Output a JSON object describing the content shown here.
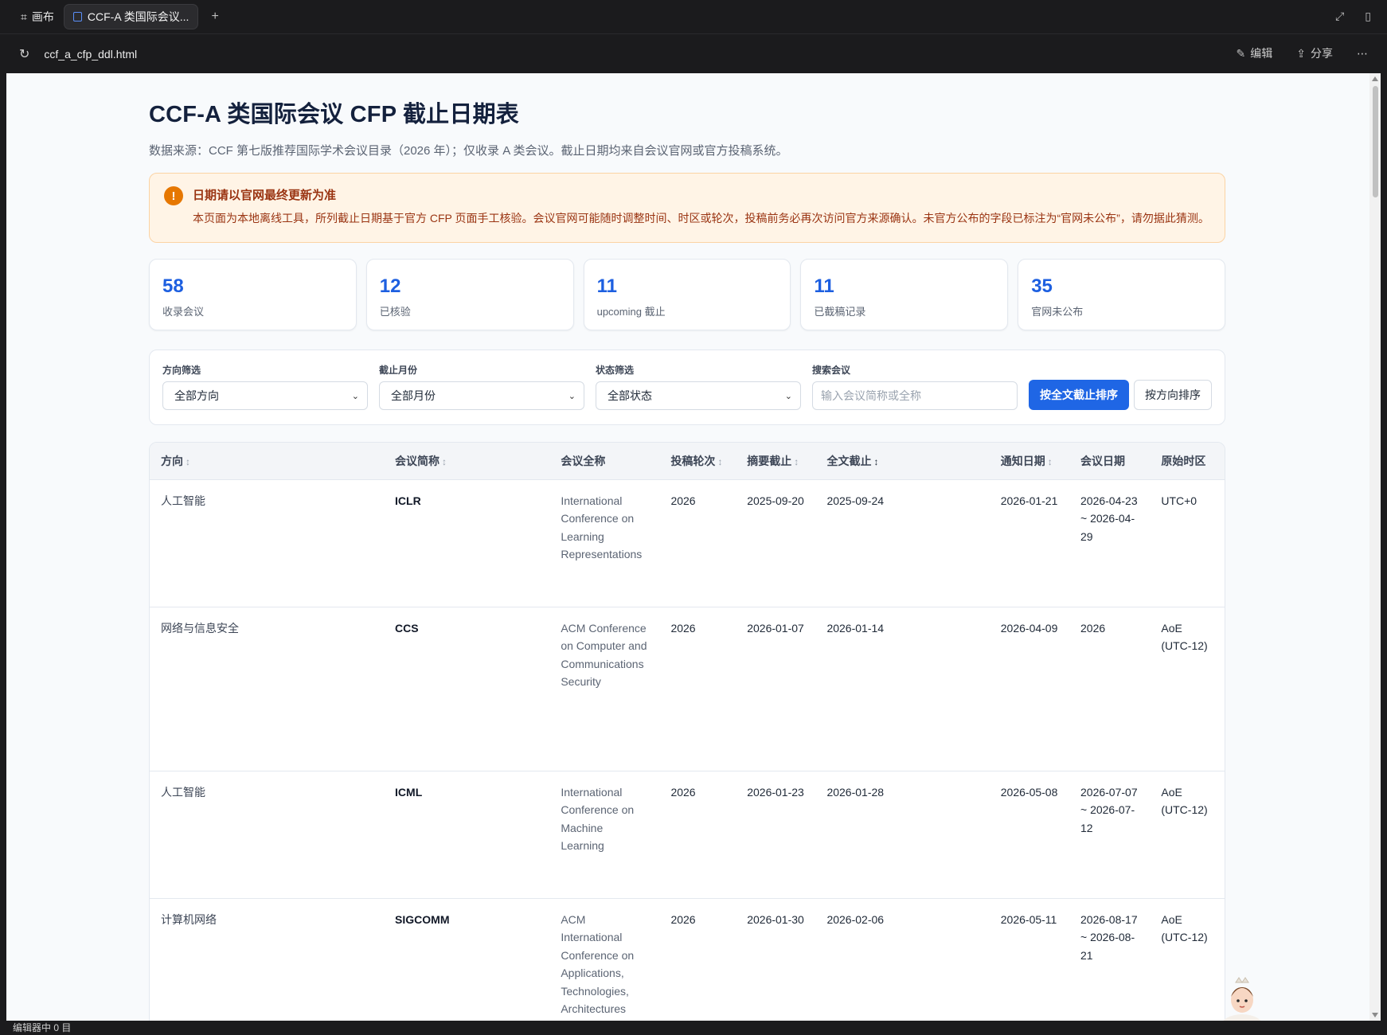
{
  "window": {
    "canvas_tab": "画布",
    "active_tab": "CCF-A 类国际会议...",
    "url": "ccf_a_cfp_ddl.html",
    "edit_label": "编辑",
    "share_label": "分享",
    "status_text": "编辑器中 0 目"
  },
  "page": {
    "title": "CCF-A 类国际会议 CFP 截止日期表",
    "subtitle": "数据来源：CCF 第七版推荐国际学术会议目录（2026 年）；仅收录 A 类会议。截止日期均来自会议官网或官方投稿系统。"
  },
  "notice": {
    "title": "日期请以官网最终更新为准",
    "body": "本页面为本地离线工具，所列截止日期基于官方 CFP 页面手工核验。会议官网可能随时调整时间、时区或轮次，投稿前务必再次访问官方来源确认。未官方公布的字段已标注为“官网未公布”，请勿据此猜测。"
  },
  "stats": [
    {
      "num": "58",
      "label": "收录会议"
    },
    {
      "num": "12",
      "label": "已核验"
    },
    {
      "num": "11",
      "label": "upcoming 截止"
    },
    {
      "num": "11",
      "label": "已截稿记录"
    },
    {
      "num": "35",
      "label": "官网未公布"
    }
  ],
  "filters": {
    "direction": {
      "label": "方向筛选",
      "value": "全部方向"
    },
    "month": {
      "label": "截止月份",
      "value": "全部月份"
    },
    "status": {
      "label": "状态筛选",
      "value": "全部状态"
    },
    "search": {
      "label": "搜索会议",
      "placeholder": "输入会议简称或全称"
    },
    "sort_deadline": "按全文截止排序",
    "sort_direction": "按方向排序"
  },
  "table": {
    "headers": {
      "direction": "方向",
      "abbr": "会议简称",
      "full": "会议全称",
      "round": "投稿轮次",
      "abstract": "摘要截止",
      "paper": "全文截止",
      "notify": "通知日期",
      "conf_date": "会议日期",
      "tz": "原始时区"
    },
    "rows": [
      {
        "direction": "人工智能",
        "abbr": "ICLR",
        "full": "International Conference on Learning Representations",
        "round": "2026",
        "abstract": "2025-09-20",
        "paper": "2025-09-24",
        "notify": "2026-01-21",
        "conf_date": "2026-04-23 ~ 2026-04-29",
        "tz": "UTC+0"
      },
      {
        "direction": "网络与信息安全",
        "abbr": "CCS",
        "full": "ACM Conference on Computer and Communications Security",
        "round": "2026",
        "abstract": "2026-01-07",
        "paper": "2026-01-14",
        "notify": "2026-04-09",
        "conf_date": "2026",
        "tz": "AoE (UTC-12)"
      },
      {
        "direction": "人工智能",
        "abbr": "ICML",
        "full": "International Conference on Machine Learning",
        "round": "2026",
        "abstract": "2026-01-23",
        "paper": "2026-01-28",
        "notify": "2026-05-08",
        "conf_date": "2026-07-07 ~ 2026-07-12",
        "tz": "AoE (UTC-12)"
      },
      {
        "direction": "计算机网络",
        "abbr": "SIGCOMM",
        "full": "ACM International Conference on Applications, Technologies, Architectures",
        "round": "2026",
        "abstract": "2026-01-30",
        "paper": "2026-02-06",
        "notify": "2026-05-11",
        "conf_date": "2026-08-17 ~ 2026-08-21",
        "tz": "AoE (UTC-12)"
      }
    ]
  },
  "colors": {
    "accent": "#1f66e5",
    "warning_bg": "#fff4e6",
    "warning_text": "#9a3412"
  }
}
